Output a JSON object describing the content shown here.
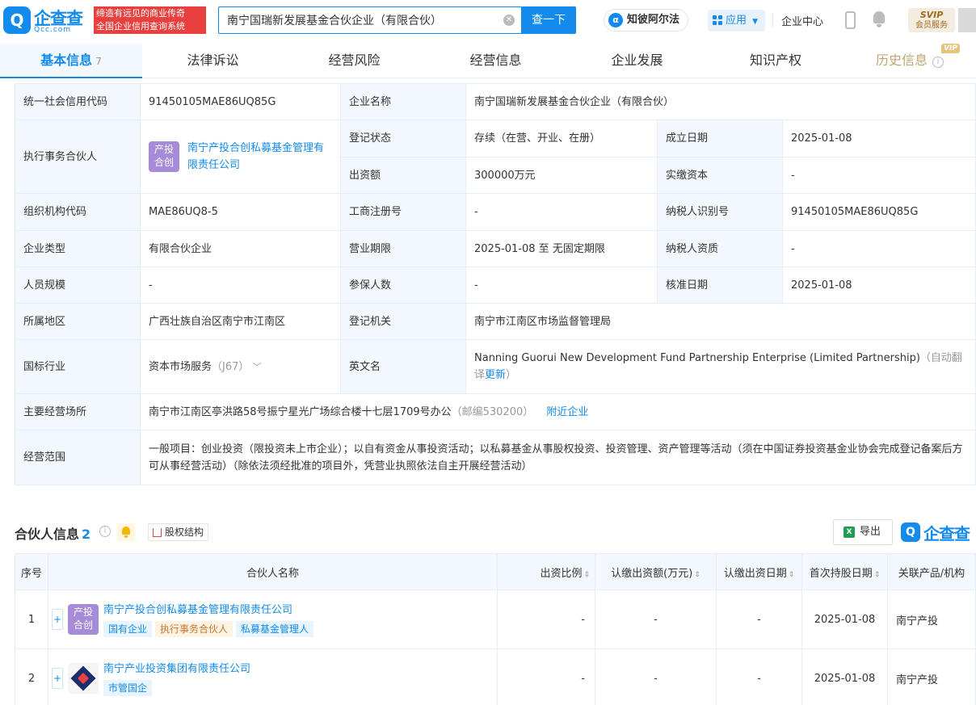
{
  "header": {
    "logo_text": "企查查",
    "logo_sub": "Qcc.com",
    "slogan_line1": "缔造有远见的商业传奇",
    "slogan_line2": "全国企业信用查询系统",
    "search_value": "南宁国瑞新发展基金合伙企业（有限合伙）",
    "search_button": "查一下",
    "zhibi": "知彼阿尔法",
    "app": "应用",
    "corp_center": "企业中心",
    "svip_title": "SVIP",
    "svip_sub": "会员服务"
  },
  "tabs": [
    {
      "label": "基本信息",
      "count": "7"
    },
    {
      "label": "法律诉讼"
    },
    {
      "label": "经营风险"
    },
    {
      "label": "经营信息"
    },
    {
      "label": "企业发展"
    },
    {
      "label": "知识产权"
    },
    {
      "label": "历史信息",
      "badge": "VIP"
    }
  ],
  "basic": {
    "credit_code_label": "统一社会信用代码",
    "credit_code": "91450105MAE86UQ85G",
    "name_label": "企业名称",
    "name": "南宁国瑞新发展基金合伙企业（有限合伙）",
    "partner_label": "执行事务合伙人",
    "partner_logo": "产投合创",
    "partner_name": "南宁产投合创私募基金管理有限责任公司",
    "status_label": "登记状态",
    "status": "存续（在营、开业、在册）",
    "found_label": "成立日期",
    "found": "2025-01-08",
    "capital_label": "出资额",
    "capital": "300000万元",
    "paid_label": "实缴资本",
    "paid": "-",
    "org_label": "组织机构代码",
    "org": "MAE86UQ8-5",
    "reg_label": "工商注册号",
    "reg": "-",
    "tax_label": "纳税人识别号",
    "tax": "91450105MAE86UQ85G",
    "type_label": "企业类型",
    "type": "有限合伙企业",
    "term_label": "营业期限",
    "term": "2025-01-08 至 无固定期限",
    "taxq_label": "纳税人资质",
    "taxq": "-",
    "staff_label": "人员规模",
    "staff": "-",
    "ins_label": "参保人数",
    "ins": "-",
    "approve_label": "核准日期",
    "approve": "2025-01-08",
    "region_label": "所属地区",
    "region": "广西壮族自治区南宁市江南区",
    "authority_label": "登记机关",
    "authority": "南宁市江南区市场监督管理局",
    "industry_label": "国标行业",
    "industry": "资本市场服务",
    "industry_code": "（J67）",
    "en_label": "英文名",
    "en": "Nanning Guorui New Development Fund Partnership Enterprise (Limited Partnership)",
    "en_note": "（自动翻译",
    "en_update": "更新",
    "en_close": "）",
    "addr_label": "主要经营场所",
    "addr": "南宁市江南区亭洪路58号振宁星光广场综合楼十七层1709号办公",
    "postcode": "（邮编530200）",
    "nearby": "附近企业",
    "scope_label": "经营范围",
    "scope": "一般项目：创业投资（限投资未上市企业）；以自有资金从事投资活动；以私募基金从事股权投资、投资管理、资产管理等活动（须在中国证券投资基金业协会完成登记备案后方可从事经营活动）（除依法须经批准的项目外，凭营业执照依法自主开展经营活动）"
  },
  "partners_section": {
    "title": "合伙人信息",
    "count": "2",
    "equity": "股权结构",
    "export": "导出",
    "watermark": "企查查"
  },
  "partners_table": {
    "headers": [
      "序号",
      "合伙人名称",
      "出资比例",
      "认缴出资额(万元)",
      "认缴出资日期",
      "首次持股日期",
      "关联产品/机构"
    ],
    "rows": [
      {
        "no": "1",
        "logo": "产投合创",
        "name": "南宁产投合创私募基金管理有限责任公司",
        "tags": [
          "国有企业",
          "执行事务合伙人",
          "私募基金管理人"
        ],
        "ratio": "-",
        "amount": "-",
        "date": "-",
        "first": "2025-01-08",
        "product": "南宁产投"
      },
      {
        "no": "2",
        "name": "南宁产业投资集团有限责任公司",
        "tags": [
          "市管国企"
        ],
        "ratio": "-",
        "amount": "-",
        "date": "-",
        "first": "2025-01-08",
        "product": "南宁产投"
      }
    ]
  }
}
